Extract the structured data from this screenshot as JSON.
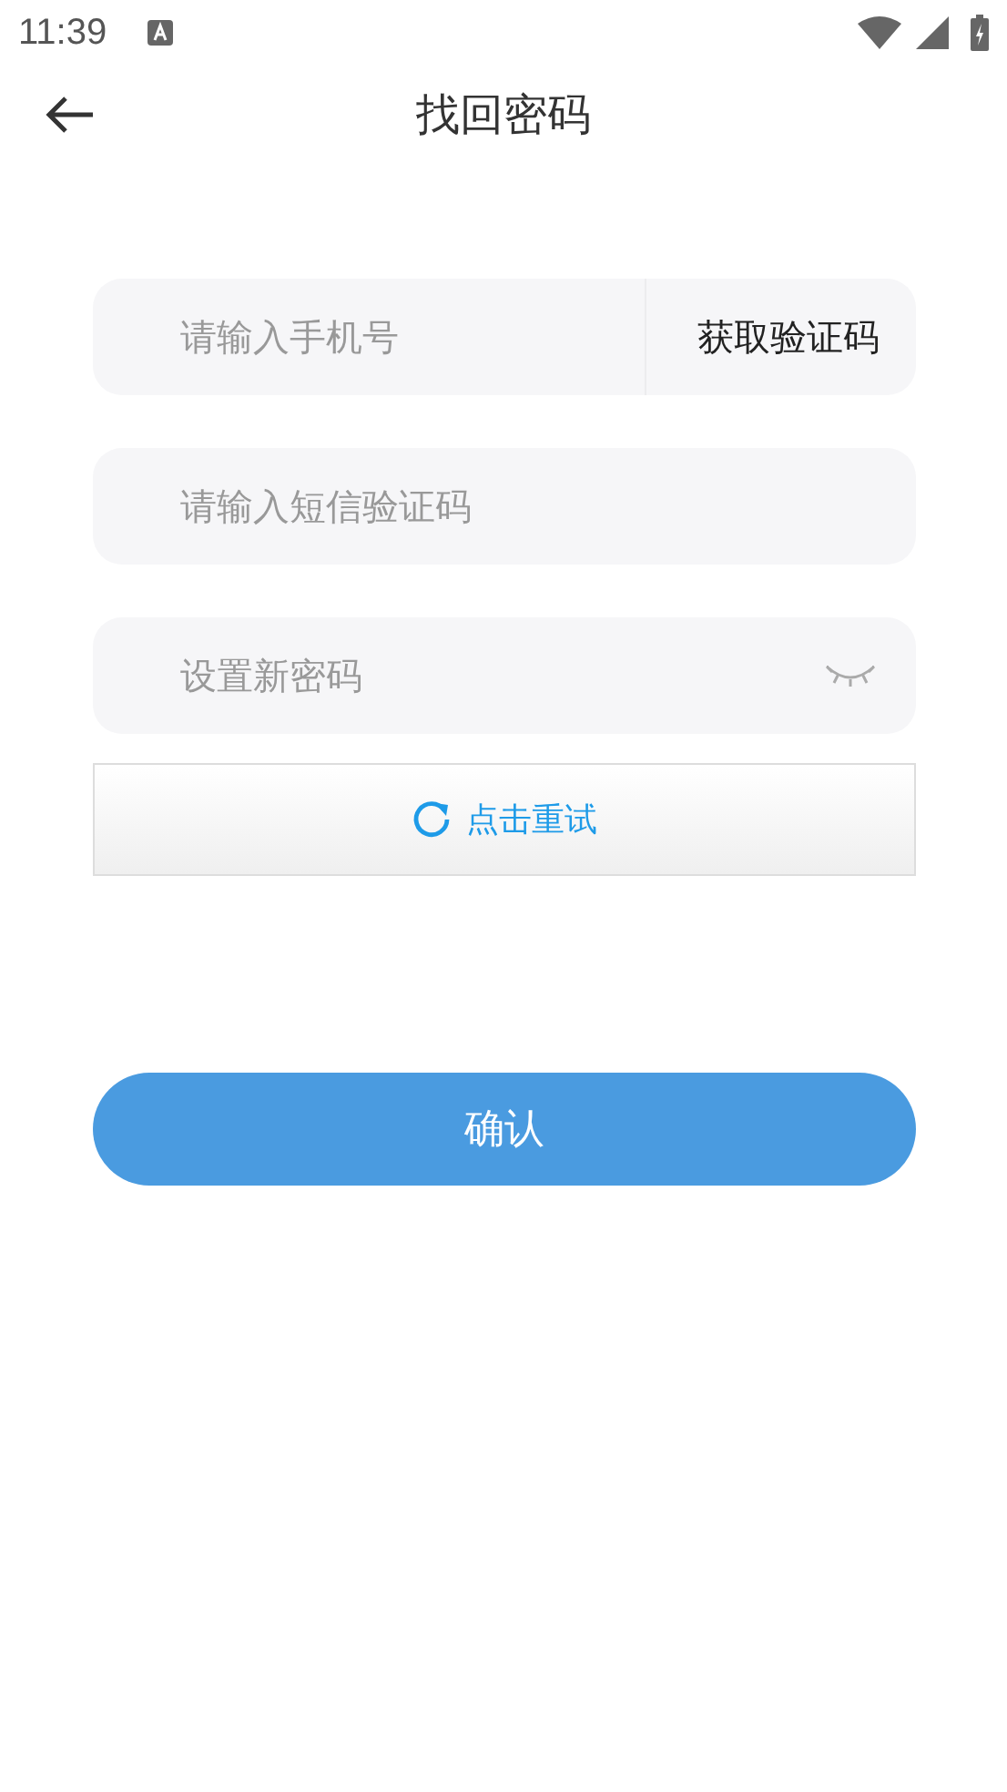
{
  "status_bar": {
    "time": "11:39"
  },
  "header": {
    "title": "找回密码"
  },
  "phone_field": {
    "placeholder": "请输入手机号"
  },
  "get_code_button": {
    "label": "获取验证码"
  },
  "sms_field": {
    "placeholder": "请输入短信验证码"
  },
  "password_field": {
    "placeholder": "设置新密码"
  },
  "captcha_retry": {
    "label": "点击重试"
  },
  "confirm_button": {
    "label": "确认"
  }
}
